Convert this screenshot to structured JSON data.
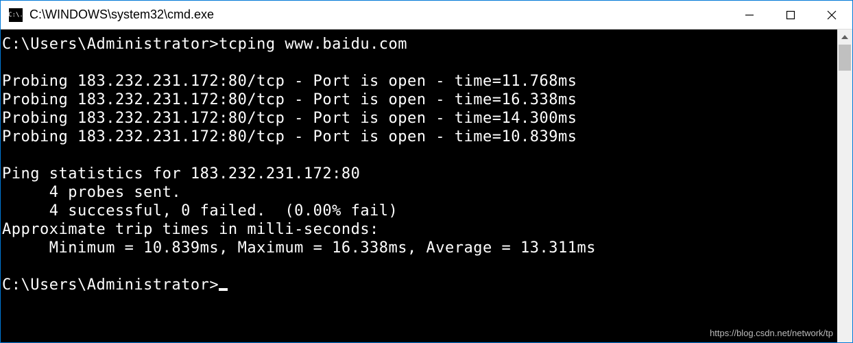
{
  "window": {
    "title": "C:\\WINDOWS\\system32\\cmd.exe",
    "icon_text": "C:\\."
  },
  "terminal": {
    "prompt1": "C:\\Users\\Administrator>",
    "command1": "tcping www.baidu.com",
    "probes": [
      "Probing 183.232.231.172:80/tcp - Port is open - time=11.768ms",
      "Probing 183.232.231.172:80/tcp - Port is open - time=16.338ms",
      "Probing 183.232.231.172:80/tcp - Port is open - time=14.300ms",
      "Probing 183.232.231.172:80/tcp - Port is open - time=10.839ms"
    ],
    "stats_header": "Ping statistics for 183.232.231.172:80",
    "stats_sent": "     4 probes sent.",
    "stats_success": "     4 successful, 0 failed.  (0.00% fail)",
    "approx_header": "Approximate trip times in milli-seconds:",
    "approx_values": "     Minimum = 10.839ms, Maximum = 16.338ms, Average = 13.311ms",
    "prompt2": "C:\\Users\\Administrator>"
  },
  "watermark": "https://blog.csdn.net/network/tp"
}
